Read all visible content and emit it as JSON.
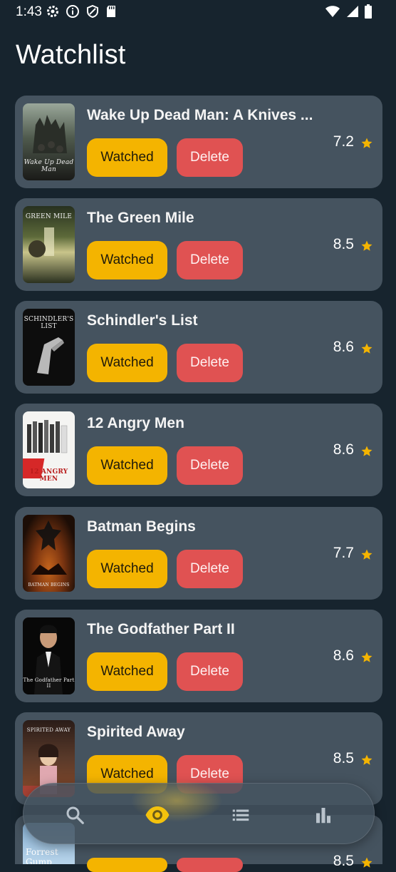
{
  "status_bar": {
    "time": "1:43",
    "left_icons": [
      "gear-icon",
      "info-icon",
      "shield-icon",
      "sd-card-icon"
    ],
    "right_icons": [
      "wifi-icon",
      "signal-icon",
      "battery-icon"
    ]
  },
  "header": {
    "title": "Watchlist"
  },
  "movies": [
    {
      "title": "Wake Up Dead Man: A Knives ...",
      "rating": "7.2",
      "poster_text": "Wake Up Dead Man",
      "watched_label": "Watched",
      "delete_label": "Delete"
    },
    {
      "title": "The Green Mile",
      "rating": "8.5",
      "poster_text": "GREEN MILE",
      "watched_label": "Watched",
      "delete_label": "Delete"
    },
    {
      "title": "Schindler's List",
      "rating": "8.6",
      "poster_text": "SCHINDLER'S LIST",
      "watched_label": "Watched",
      "delete_label": "Delete"
    },
    {
      "title": "12 Angry Men",
      "rating": "8.6",
      "poster_text": "12 ANGRY MEN",
      "watched_label": "Watched",
      "delete_label": "Delete"
    },
    {
      "title": "Batman Begins",
      "rating": "7.7",
      "poster_text": "BATMAN BEGINS",
      "watched_label": "Watched",
      "delete_label": "Delete"
    },
    {
      "title": "The Godfather Part II",
      "rating": "8.6",
      "poster_text": "The Godfather Part II",
      "watched_label": "Watched",
      "delete_label": "Delete"
    },
    {
      "title": "Spirited Away",
      "rating": "8.5",
      "poster_text": "SPIRITED AWAY",
      "watched_label": "Watched",
      "delete_label": "Delete"
    },
    {
      "title": "",
      "rating": "8.5",
      "poster_text": "Forrest Gump",
      "watched_label": "",
      "delete_label": ""
    }
  ],
  "nav": {
    "items": [
      {
        "icon": "search-icon",
        "active": false
      },
      {
        "icon": "eye-icon",
        "active": true
      },
      {
        "icon": "list-icon",
        "active": false
      },
      {
        "icon": "bar-chart-icon",
        "active": false
      }
    ]
  },
  "colors": {
    "background": "#17242e",
    "card": "#45535f",
    "watched_button": "#f4b400",
    "delete_button": "#e05252",
    "star": "#f4b400",
    "active_nav": "#f4c20d"
  }
}
